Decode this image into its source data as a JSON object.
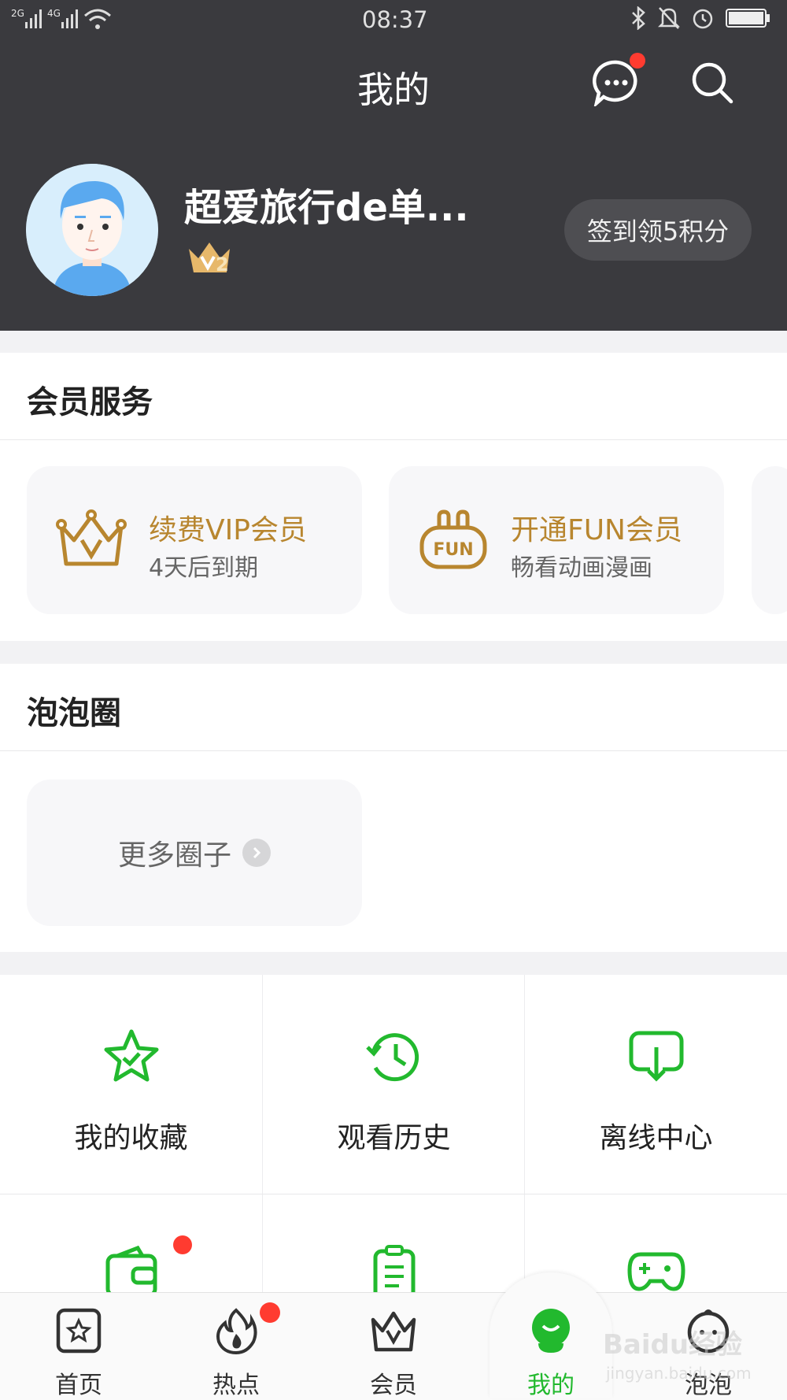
{
  "status_bar": {
    "signal1": "2G",
    "signal2": "4G",
    "time": "08:37"
  },
  "header": {
    "title": "我的",
    "username": "超爱旅行de单...",
    "vip_level": "2",
    "signin_label": "签到领5积分"
  },
  "member_services": {
    "title": "会员服务",
    "cards": [
      {
        "title": "续费VIP会员",
        "subtitle": "4天后到期",
        "icon": "crown-icon"
      },
      {
        "title": "开通FUN会员",
        "subtitle": "畅看动画漫画",
        "icon": "fun-icon"
      }
    ]
  },
  "bubble_circle": {
    "title": "泡泡圈",
    "more_label": "更多圈子"
  },
  "grid": [
    {
      "label": "我的收藏",
      "icon": "star-icon"
    },
    {
      "label": "观看历史",
      "icon": "history-icon"
    },
    {
      "label": "离线中心",
      "icon": "download-icon"
    },
    {
      "label": "",
      "icon": "wallet-icon"
    },
    {
      "label": "",
      "icon": "clipboard-icon"
    },
    {
      "label": "",
      "icon": "gamepad-icon"
    }
  ],
  "bottom_nav": [
    {
      "label": "首页",
      "icon": "home-icon"
    },
    {
      "label": "热点",
      "icon": "fire-icon"
    },
    {
      "label": "会员",
      "icon": "crown-icon"
    },
    {
      "label": "我的",
      "icon": "profile-icon"
    },
    {
      "label": "泡泡",
      "icon": "bubble-icon"
    }
  ],
  "watermark": {
    "text": "Baidu经验",
    "sub": "jingyan.baidu.com"
  },
  "colors": {
    "accent": "#22b92e",
    "gold": "#b8862f",
    "header_bg": "#3a3a3e",
    "badge_red": "#ff3b30"
  }
}
